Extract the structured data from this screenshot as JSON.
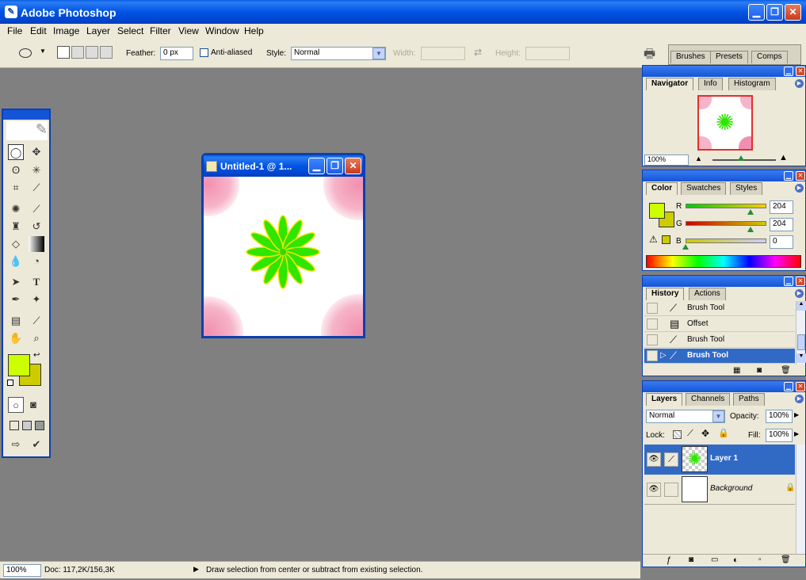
{
  "app": {
    "title": "Adobe Photoshop"
  },
  "menu": [
    "File",
    "Edit",
    "Image",
    "Layer",
    "Select",
    "Filter",
    "View",
    "Window",
    "Help"
  ],
  "options": {
    "feather_label": "Feather:",
    "feather_value": "0 px",
    "antialias_label": "Anti-aliased",
    "style_label": "Style:",
    "style_value": "Normal",
    "width_label": "Width:",
    "height_label": "Height:",
    "well_tabs": [
      "Brushes",
      "Presets",
      "Comps"
    ]
  },
  "document": {
    "title": "Untitled-1 @ 1..."
  },
  "navigator": {
    "tabs": [
      "Navigator",
      "Info",
      "Histogram"
    ],
    "zoom": "100%"
  },
  "color": {
    "tabs": [
      "Color",
      "Swatches",
      "Styles"
    ],
    "channels": [
      {
        "label": "R",
        "value": "204",
        "position": 0.8
      },
      {
        "label": "G",
        "value": "204",
        "position": 0.8
      },
      {
        "label": "B",
        "value": "0",
        "position": 0.0
      }
    ],
    "foreground": "#ccff00",
    "background": "#cccc00"
  },
  "history": {
    "tabs": [
      "History",
      "Actions"
    ],
    "items": [
      {
        "label": "Brush Tool",
        "icon": "brush-icon"
      },
      {
        "label": "Offset",
        "icon": "filter-icon"
      },
      {
        "label": "Brush Tool",
        "icon": "brush-icon"
      },
      {
        "label": "Brush Tool",
        "icon": "brush-icon",
        "selected": true
      }
    ]
  },
  "layers": {
    "tabs": [
      "Layers",
      "Channels",
      "Paths"
    ],
    "blend_mode": "Normal",
    "opacity_label": "Opacity:",
    "opacity": "100%",
    "lock_label": "Lock:",
    "fill_label": "Fill:",
    "fill": "100%",
    "items": [
      {
        "name": "Layer 1",
        "selected": true
      },
      {
        "name": "Background",
        "selected": false
      }
    ]
  },
  "status": {
    "zoom": "100%",
    "doc": "Doc: 117,2K/156,3K",
    "hint": "Draw selection from center or subtract from existing selection."
  }
}
